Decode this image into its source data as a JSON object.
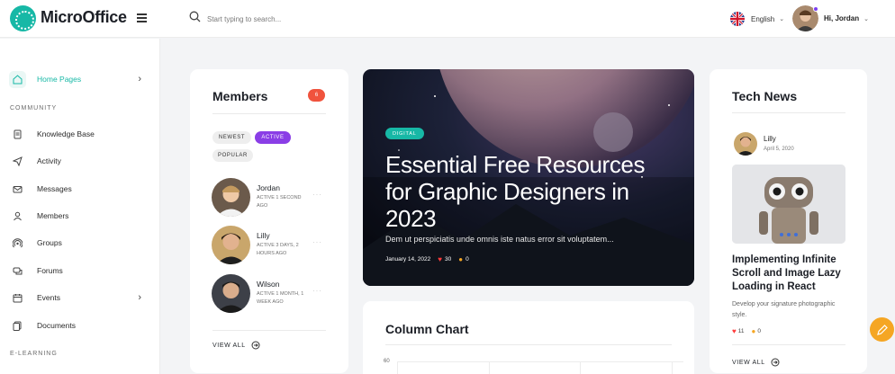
{
  "app": {
    "name": "MicroOffice"
  },
  "header": {
    "search_placeholder": "Start typing to search...",
    "language": "English",
    "greeting": "Hi,",
    "user_name": "Jordan"
  },
  "sidebar": {
    "home": "Home Pages",
    "community_label": "COMMUNITY",
    "items": [
      {
        "label": "Knowledge Base",
        "icon": "document-icon"
      },
      {
        "label": "Activity",
        "icon": "send-icon"
      },
      {
        "label": "Messages",
        "icon": "mail-icon"
      },
      {
        "label": "Members",
        "icon": "user-icon"
      },
      {
        "label": "Groups",
        "icon": "broadcast-icon"
      },
      {
        "label": "Forums",
        "icon": "chat-icon"
      },
      {
        "label": "Events",
        "icon": "calendar-icon"
      },
      {
        "label": "Documents",
        "icon": "files-icon"
      }
    ],
    "elearning_label": "E-LEARNING"
  },
  "members": {
    "title": "Members",
    "count": "6",
    "filters": [
      "NEWEST",
      "ACTIVE",
      "POPULAR"
    ],
    "active_filter": "ACTIVE",
    "list": [
      {
        "name": "Jordan",
        "status": "ACTIVE 1 SECOND AGO"
      },
      {
        "name": "Lilly",
        "status": "ACTIVE 3 DAYS, 2 HOURS AGO"
      },
      {
        "name": "Wilson",
        "status": "ACTIVE 1 MONTH, 1 WEEK AGO"
      }
    ],
    "view_all": "VIEW ALL"
  },
  "featured": {
    "tag": "DIGITAL",
    "title": "Essential Free Resources for Graphic Designers in 2023",
    "excerpt": "Dem ut perspiciatis unde omnis iste natus error sit voluptatem...",
    "date": "January 14, 2022",
    "likes": "30",
    "comments": "0"
  },
  "chart": {
    "title": "Column Chart",
    "y_tick_top": "60"
  },
  "tech_news": {
    "title": "Tech News",
    "author": "Lilly",
    "date": "April 5, 2020",
    "headline": "Implementing Infinite Scroll and Image Lazy Loading in React",
    "excerpt": "Develop your signature photographic style.",
    "likes": "11",
    "comments": "0",
    "view_all": "VIEW ALL"
  },
  "colors": {
    "brand": "#17b8a6",
    "accent_purple": "#8a3ee6",
    "badge_red": "#f0533d",
    "fab": "#f5a623"
  }
}
